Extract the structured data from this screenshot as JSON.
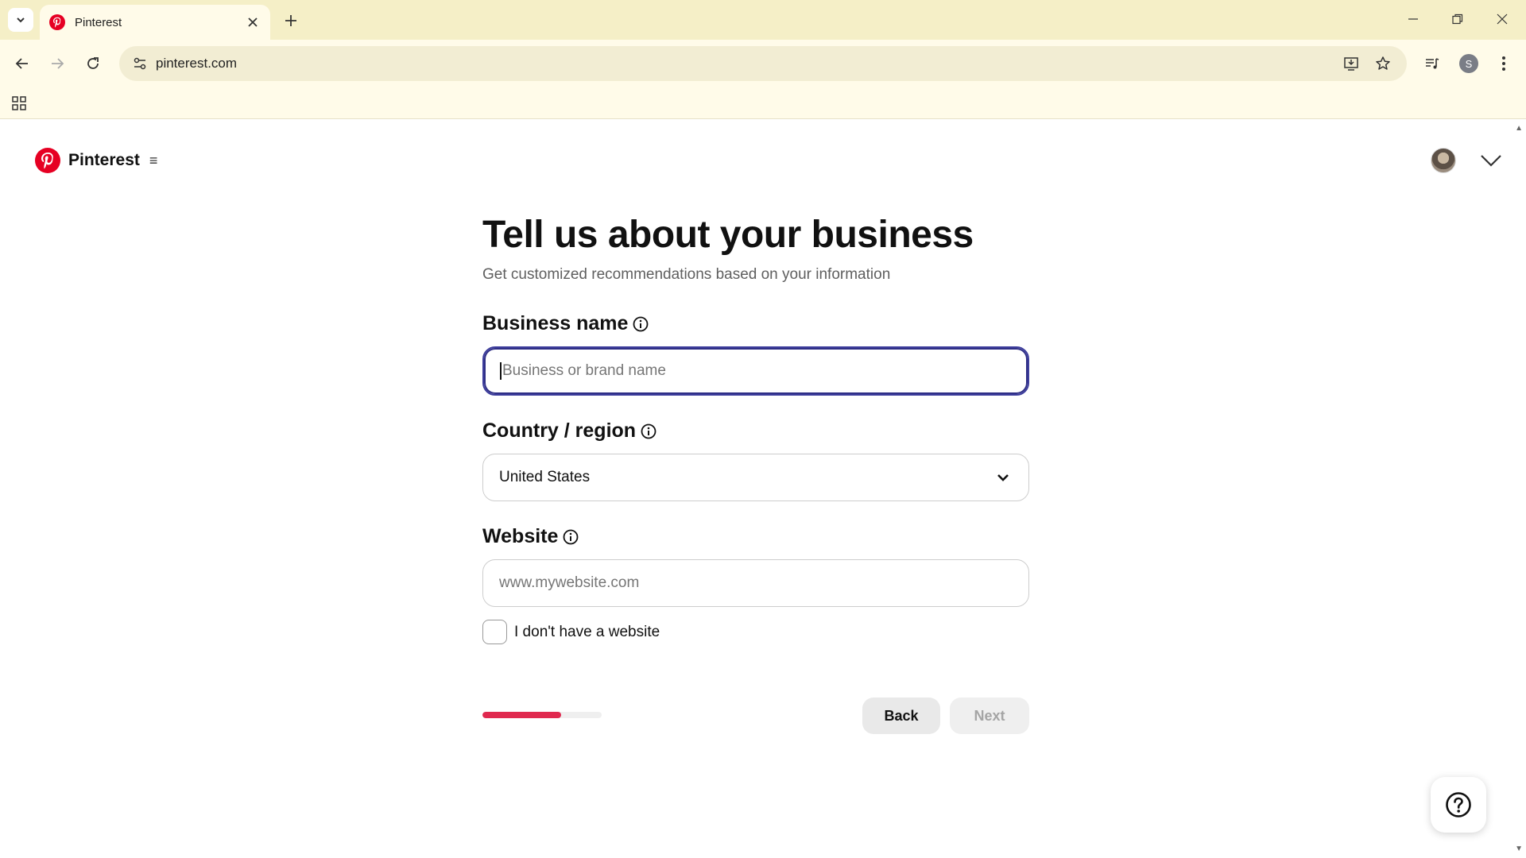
{
  "browser": {
    "tab_title": "Pinterest",
    "url": "pinterest.com",
    "profile_initial": "S",
    "icons": [
      "tab-list-icon",
      "pinterest-favicon",
      "close-icon",
      "plus-icon",
      "minimize-icon",
      "restore-icon",
      "window-close-icon",
      "back-arrow-icon",
      "forward-arrow-icon",
      "reload-icon",
      "site-settings-icon",
      "install-app-icon",
      "bookmark-star-icon",
      "media-control-icon",
      "kebab-menu-icon",
      "apps-grid-icon"
    ]
  },
  "header": {
    "brand_name": "Pinterest",
    "menu_glyph": "≡"
  },
  "form": {
    "title": "Tell us about your business",
    "subtitle": "Get customized recommendations based on your information",
    "business_name_label": "Business name",
    "business_name_value": "",
    "business_name_placeholder": "Business or brand name",
    "country_label": "Country / region",
    "country_value": "United States",
    "website_label": "Website",
    "website_value": "",
    "website_placeholder": "www.mywebsite.com",
    "no_website_label": "I don't have a website",
    "no_website_checked": false
  },
  "footer": {
    "progress_fraction": 0.66,
    "back_label": "Back",
    "next_label": "Next"
  },
  "colors": {
    "brand_red": "#e60023",
    "progress_red": "#e0294f",
    "focus_ring": "#3d3d9c",
    "chrome_bg": "#f5efc7"
  }
}
